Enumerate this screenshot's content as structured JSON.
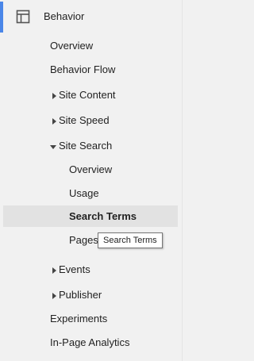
{
  "section": {
    "label": "Behavior",
    "icon": "layout-icon"
  },
  "items": [
    {
      "label": "Overview"
    },
    {
      "label": "Behavior Flow"
    },
    {
      "label": "Site Content",
      "expander": "collapsed"
    },
    {
      "label": "Site Speed",
      "expander": "collapsed"
    },
    {
      "label": "Site Search",
      "expander": "expanded"
    },
    {
      "label": "Overview"
    },
    {
      "label": "Usage"
    },
    {
      "label": "Search Terms",
      "selected": true
    },
    {
      "label": "Pages"
    },
    {
      "label": "Events",
      "expander": "collapsed"
    },
    {
      "label": "Publisher",
      "expander": "collapsed"
    },
    {
      "label": "Experiments"
    },
    {
      "label": "In-Page Analytics"
    }
  ],
  "tooltip": {
    "text": "Search Terms"
  },
  "colors": {
    "accent": "#4a86e8",
    "selected_bg": "#e2e2e2",
    "background": "#f1f1f1"
  }
}
